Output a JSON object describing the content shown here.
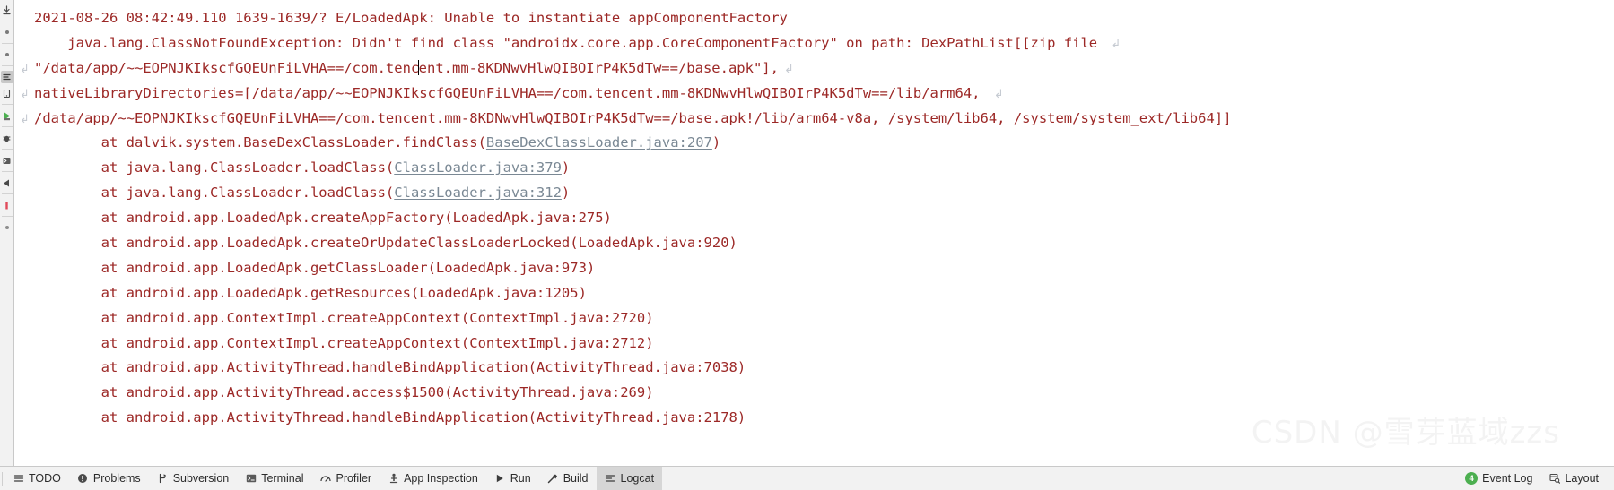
{
  "logcat": {
    "lines": [
      {
        "indent": 0,
        "wrap_mark": "",
        "segments": [
          {
            "text": "2021-08-26 08:42:49.110 1639-1639/? E/LoadedApk: Unable to instantiate appComponentFactory",
            "kind": "plain"
          }
        ],
        "eol_wrap": false
      },
      {
        "indent": 0,
        "wrap_mark": "",
        "segments": [
          {
            "text": "    java.lang.ClassNotFoundException: Didn't find class \"androidx.core.app.CoreComponentFactory\" on path: DexPathList[[zip file ",
            "kind": "plain"
          }
        ],
        "eol_wrap": true
      },
      {
        "indent": 0,
        "wrap_mark": "↲",
        "segments": [
          {
            "text": "\"/data/app/~~EOPNJKIkscfGQEUnFiLVHA==/com.tenc",
            "kind": "plain"
          },
          {
            "text": "",
            "kind": "caret"
          },
          {
            "text": "ent.mm-8KDNwvHlwQIBOIrP4K5dTw==/base.apk\"],",
            "kind": "plain"
          }
        ],
        "eol_wrap": true
      },
      {
        "indent": 0,
        "wrap_mark": "↲",
        "segments": [
          {
            "text": "nativeLibraryDirectories=[/data/app/~~EOPNJKIkscfGQEUnFiLVHA==/com.tencent.mm-8KDNwvHlwQIBOIrP4K5dTw==/lib/arm64, ",
            "kind": "plain"
          }
        ],
        "eol_wrap": true
      },
      {
        "indent": 0,
        "wrap_mark": "↲",
        "segments": [
          {
            "text": "/data/app/~~EOPNJKIkscfGQEUnFiLVHA==/com.tencent.mm-8KDNwvHlwQIBOIrP4K5dTw==/base.apk!/lib/arm64-v8a, /system/lib64, /system/system_ext/lib64]]",
            "kind": "plain"
          }
        ],
        "eol_wrap": false
      },
      {
        "indent": 0,
        "wrap_mark": "",
        "segments": [
          {
            "text": "        at dalvik.system.BaseDexClassLoader.findClass(",
            "kind": "plain"
          },
          {
            "text": "BaseDexClassLoader.java:207",
            "kind": "link"
          },
          {
            "text": ")",
            "kind": "plain"
          }
        ],
        "eol_wrap": false
      },
      {
        "indent": 0,
        "wrap_mark": "",
        "segments": [
          {
            "text": "        at java.lang.ClassLoader.loadClass(",
            "kind": "plain"
          },
          {
            "text": "ClassLoader.java:379",
            "kind": "link"
          },
          {
            "text": ")",
            "kind": "plain"
          }
        ],
        "eol_wrap": false
      },
      {
        "indent": 0,
        "wrap_mark": "",
        "segments": [
          {
            "text": "        at java.lang.ClassLoader.loadClass(",
            "kind": "plain"
          },
          {
            "text": "ClassLoader.java:312",
            "kind": "link"
          },
          {
            "text": ")",
            "kind": "plain"
          }
        ],
        "eol_wrap": false
      },
      {
        "indent": 0,
        "wrap_mark": "",
        "segments": [
          {
            "text": "        at android.app.LoadedApk.createAppFactory(LoadedApk.java:275)",
            "kind": "plain"
          }
        ],
        "eol_wrap": false
      },
      {
        "indent": 0,
        "wrap_mark": "",
        "segments": [
          {
            "text": "        at android.app.LoadedApk.createOrUpdateClassLoaderLocked(LoadedApk.java:920)",
            "kind": "plain"
          }
        ],
        "eol_wrap": false
      },
      {
        "indent": 0,
        "wrap_mark": "",
        "segments": [
          {
            "text": "        at android.app.LoadedApk.getClassLoader(LoadedApk.java:973)",
            "kind": "plain"
          }
        ],
        "eol_wrap": false
      },
      {
        "indent": 0,
        "wrap_mark": "",
        "segments": [
          {
            "text": "        at android.app.LoadedApk.getResources(LoadedApk.java:1205)",
            "kind": "plain"
          }
        ],
        "eol_wrap": false
      },
      {
        "indent": 0,
        "wrap_mark": "",
        "segments": [
          {
            "text": "        at android.app.ContextImpl.createAppContext(ContextImpl.java:2720)",
            "kind": "plain"
          }
        ],
        "eol_wrap": false
      },
      {
        "indent": 0,
        "wrap_mark": "",
        "segments": [
          {
            "text": "        at android.app.ContextImpl.createAppContext(ContextImpl.java:2712)",
            "kind": "plain"
          }
        ],
        "eol_wrap": false
      },
      {
        "indent": 0,
        "wrap_mark": "",
        "segments": [
          {
            "text": "        at android.app.ActivityThread.handleBindApplication(ActivityThread.java:7038)",
            "kind": "plain"
          }
        ],
        "eol_wrap": false
      },
      {
        "indent": 0,
        "wrap_mark": "",
        "segments": [
          {
            "text": "        at android.app.ActivityThread.access$1500(ActivityThread.java:269)",
            "kind": "plain"
          }
        ],
        "eol_wrap": false
      },
      {
        "indent": 0,
        "wrap_mark": "",
        "segments": [
          {
            "text": "        at android.app.ActivityThread.handleBindApplication(ActivityThread.java:2178)",
            "kind": "plain"
          }
        ],
        "eol_wrap": false
      }
    ],
    "text_color": "#9c2826",
    "link_color": "#7a8894",
    "wrap_mark_color": "#c6cbd2"
  },
  "left_rail": {
    "items": [
      {
        "icon": "download-icon",
        "selected": false
      },
      {
        "icon": "dot-small-icon",
        "selected": false
      },
      {
        "icon": "dot-small-icon-2",
        "selected": false
      },
      {
        "icon": "logcat-rail-icon",
        "selected": true
      },
      {
        "icon": "device-icon",
        "selected": false
      },
      {
        "icon": "run-green-icon",
        "selected": false
      },
      {
        "icon": "debug-bug-icon",
        "selected": false
      },
      {
        "icon": "terminal-rail-icon",
        "selected": false
      },
      {
        "icon": "back-arrow-icon",
        "selected": false
      },
      {
        "icon": "error-red-icon",
        "selected": false
      },
      {
        "icon": "dot-gray-icon",
        "selected": false
      }
    ]
  },
  "status_bar": {
    "left_items": [
      {
        "label": "TODO",
        "icon": "list-icon",
        "active": false
      },
      {
        "label": "Problems",
        "icon": "exclamation-circle-icon",
        "active": false
      },
      {
        "label": "Subversion",
        "icon": "branch-icon",
        "active": false
      },
      {
        "label": "Terminal",
        "icon": "terminal-icon",
        "active": false
      },
      {
        "label": "Profiler",
        "icon": "profiler-icon",
        "active": false
      },
      {
        "label": "App Inspection",
        "icon": "inspection-icon",
        "active": false
      },
      {
        "label": "Run",
        "icon": "play-icon",
        "active": false
      },
      {
        "label": "Build",
        "icon": "hammer-icon",
        "active": false
      },
      {
        "label": "Logcat",
        "icon": "logcat-icon",
        "active": true
      }
    ],
    "right_items": [
      {
        "label": "Event Log",
        "icon": "event-log-badge",
        "badge": "4"
      },
      {
        "label": "Layout",
        "icon": "layout-icon",
        "badge": ""
      }
    ],
    "accent_green": "#4caf50",
    "active_bg": "#d6d6d6"
  },
  "watermark": {
    "text": "CSDN @雪芽蓝域zzs"
  }
}
